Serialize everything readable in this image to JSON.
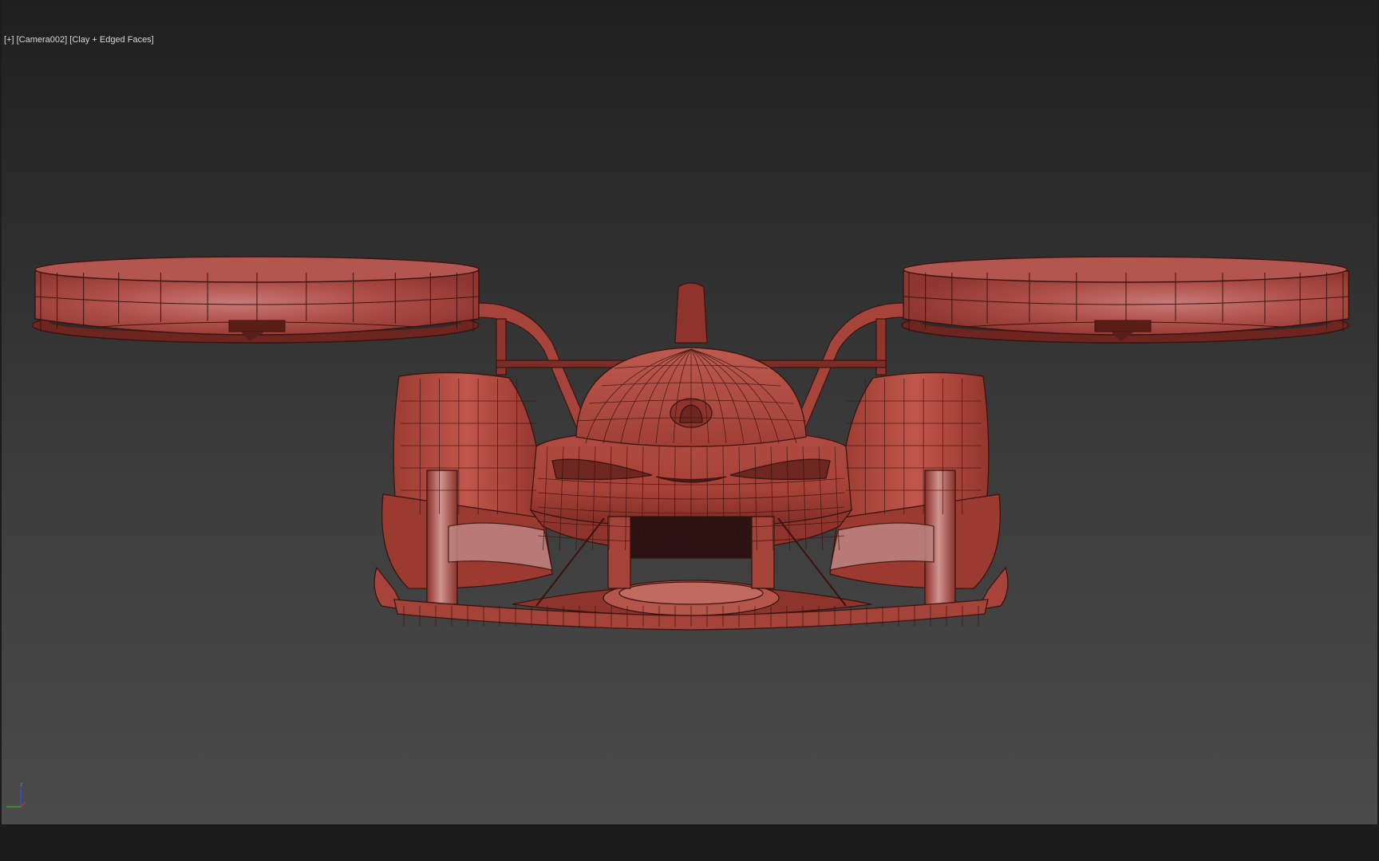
{
  "viewport": {
    "label_plus": "[+]",
    "label_camera": "[Camera002]",
    "label_shading": "[Clay + Edged Faces]",
    "gizmo_axis_label": "z"
  },
  "colors": {
    "background_top": "#1f1f1f",
    "background_bottom": "#4a4a4a",
    "clay": "#b8473c",
    "clay_dark": "#7a2a24",
    "clay_highlight": "#d38a86",
    "wire": "#3b1410",
    "axis_x": "#c03030",
    "axis_y": "#30a030",
    "axis_z": "#3050d0"
  },
  "icons": {
    "axis_gizmo": "xyz-axis-tripod-icon"
  }
}
